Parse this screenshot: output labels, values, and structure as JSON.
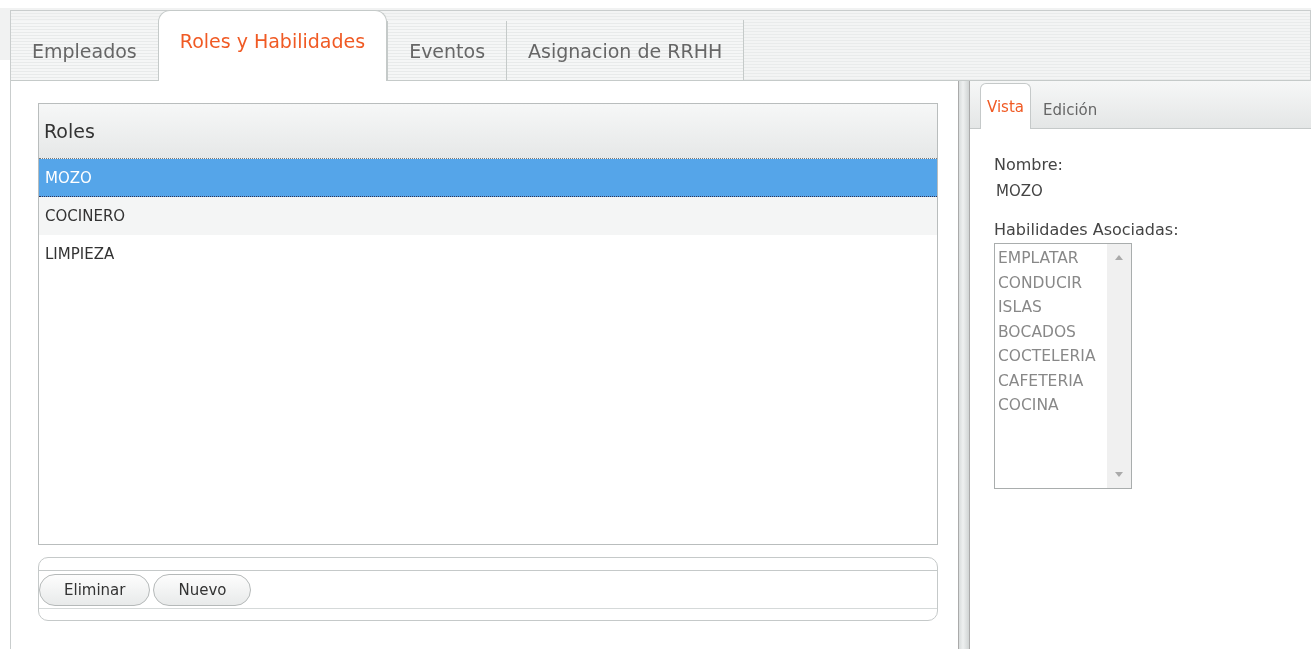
{
  "tabs": [
    {
      "label": "Empleados",
      "selected": false
    },
    {
      "label": "Roles y Habilidades",
      "selected": true
    },
    {
      "label": "Eventos",
      "selected": false
    },
    {
      "label": "Asignacion de RRHH",
      "selected": false
    }
  ],
  "roles": {
    "header": "Roles",
    "rows": [
      {
        "label": "MOZO",
        "selected": true
      },
      {
        "label": "COCINERO",
        "selected": false
      },
      {
        "label": "LIMPIEZA",
        "selected": false
      }
    ]
  },
  "buttons": [
    "Eliminar",
    "Nuevo"
  ],
  "detail": {
    "tabs": [
      {
        "label": "Vista",
        "selected": true
      },
      {
        "label": "Edición",
        "selected": false
      }
    ],
    "name_label": "Nombre:",
    "name_value": "MOZO",
    "skills_label": "Habilidades Asociadas:",
    "skills": [
      "EMPLATAR",
      "CONDUCIR",
      "ISLAS",
      "BOCADOS",
      "COCTELERIA",
      "CAFETERIA",
      "COCINA"
    ]
  }
}
